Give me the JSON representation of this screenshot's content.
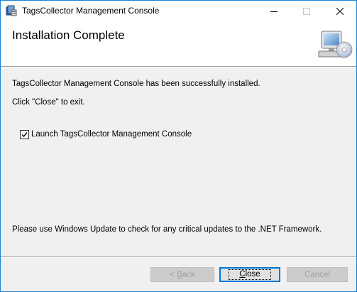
{
  "window": {
    "title": "TagsCollector Management Console"
  },
  "banner": {
    "title": "Installation Complete",
    "icon": "computer-cd-icon"
  },
  "content": {
    "success_message": "TagsCollector Management Console has been successfully installed.",
    "instruction": "Click \"Close\" to exit.",
    "launch_checkbox": {
      "label": "Launch TagsCollector Management Console",
      "checked": true
    },
    "update_note": "Please use Windows Update to check for any critical updates to the .NET Framework."
  },
  "buttons": {
    "back_label_mnemonic": "B",
    "back_label_rest": "ack",
    "back_prefix": "< ",
    "close_label_mnemonic": "C",
    "close_label_rest": "lose",
    "cancel_label": "Cancel"
  },
  "colors": {
    "accent": "#0078d7",
    "window_border": "#1883d7",
    "dialog_bg": "#f0f0f0"
  }
}
